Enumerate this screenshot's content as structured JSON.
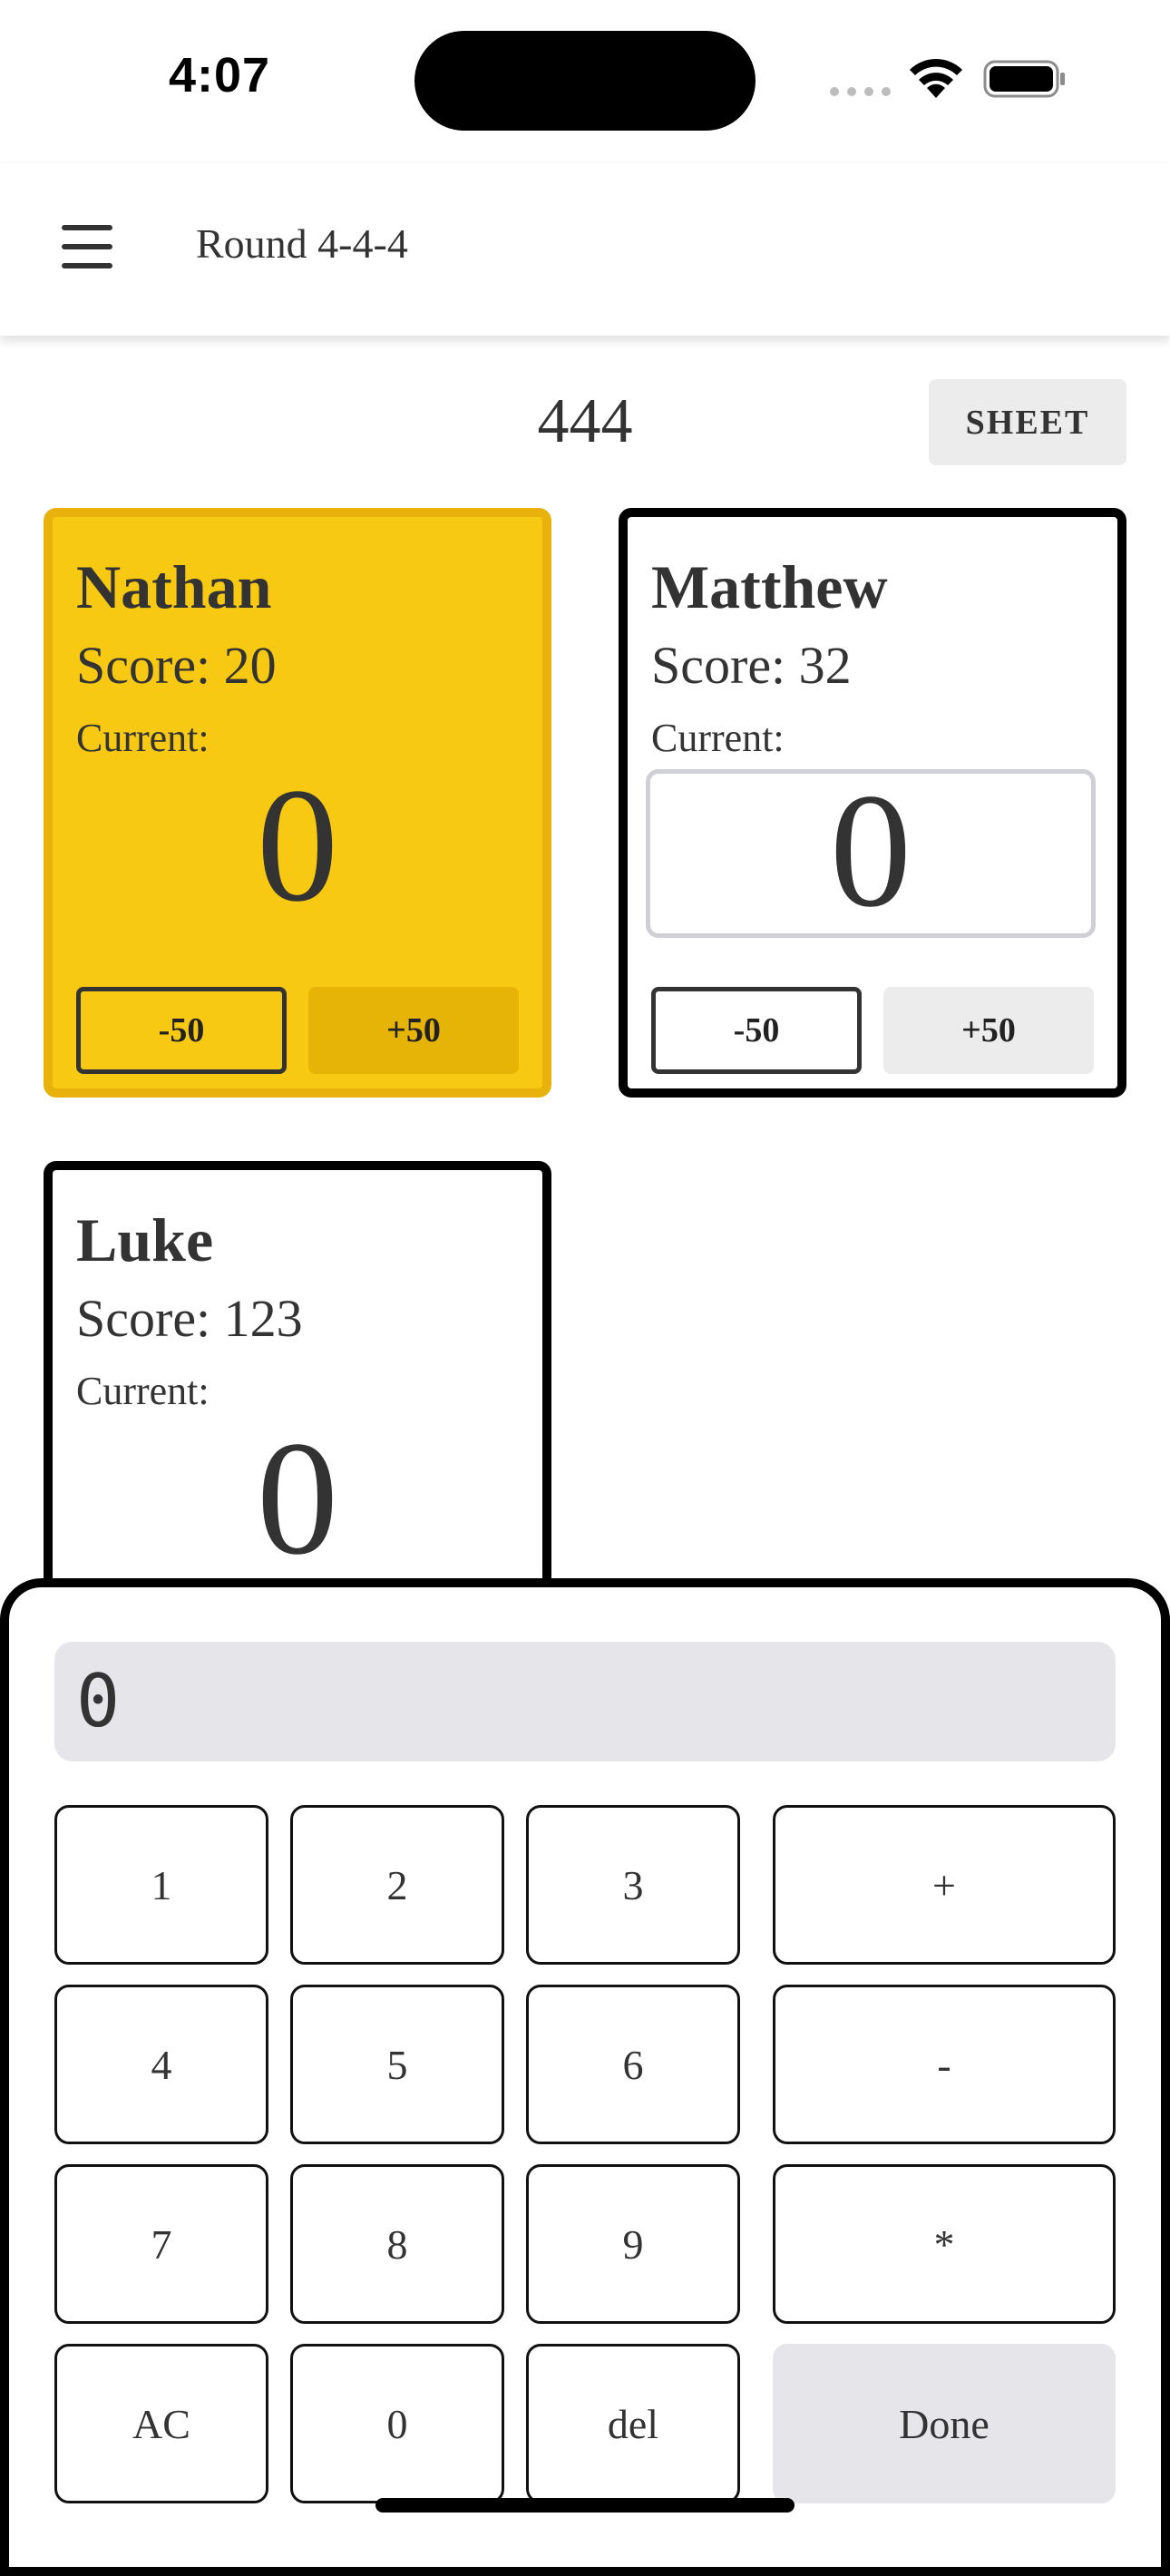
{
  "status_bar": {
    "time": "4:07",
    "icons": [
      "signal-icon",
      "wifi-icon",
      "battery-icon"
    ]
  },
  "header": {
    "menu_icon": "hamburger-menu-icon",
    "title": "Round 4-4-4"
  },
  "round": {
    "total": "444",
    "sheet_label": "SHEET"
  },
  "players": [
    {
      "name": "Nathan",
      "score": "Score: 20",
      "current_label": "Current:",
      "current_value": "0",
      "minus_label": "-50",
      "plus_label": "+50",
      "active": true
    },
    {
      "name": "Matthew",
      "score": "Score: 32",
      "current_label": "Current:",
      "current_value": "0",
      "minus_label": "-50",
      "plus_label": "+50",
      "active": false
    },
    {
      "name": "Luke",
      "score": "Score: 123",
      "current_label": "Current:",
      "current_value": "0",
      "active": false
    }
  ],
  "keypad": {
    "display": "0",
    "keys": [
      "1",
      "2",
      "3",
      "+",
      "4",
      "5",
      "6",
      "-",
      "7",
      "8",
      "9",
      "*",
      "AC",
      "0",
      "del",
      "Done"
    ]
  },
  "colors": {
    "active_card": "#f8c913",
    "active_border": "#e8b10b",
    "active_plus": "#e6b307",
    "neutral_button": "#ececec",
    "display_bg": "#e5e5ea"
  }
}
